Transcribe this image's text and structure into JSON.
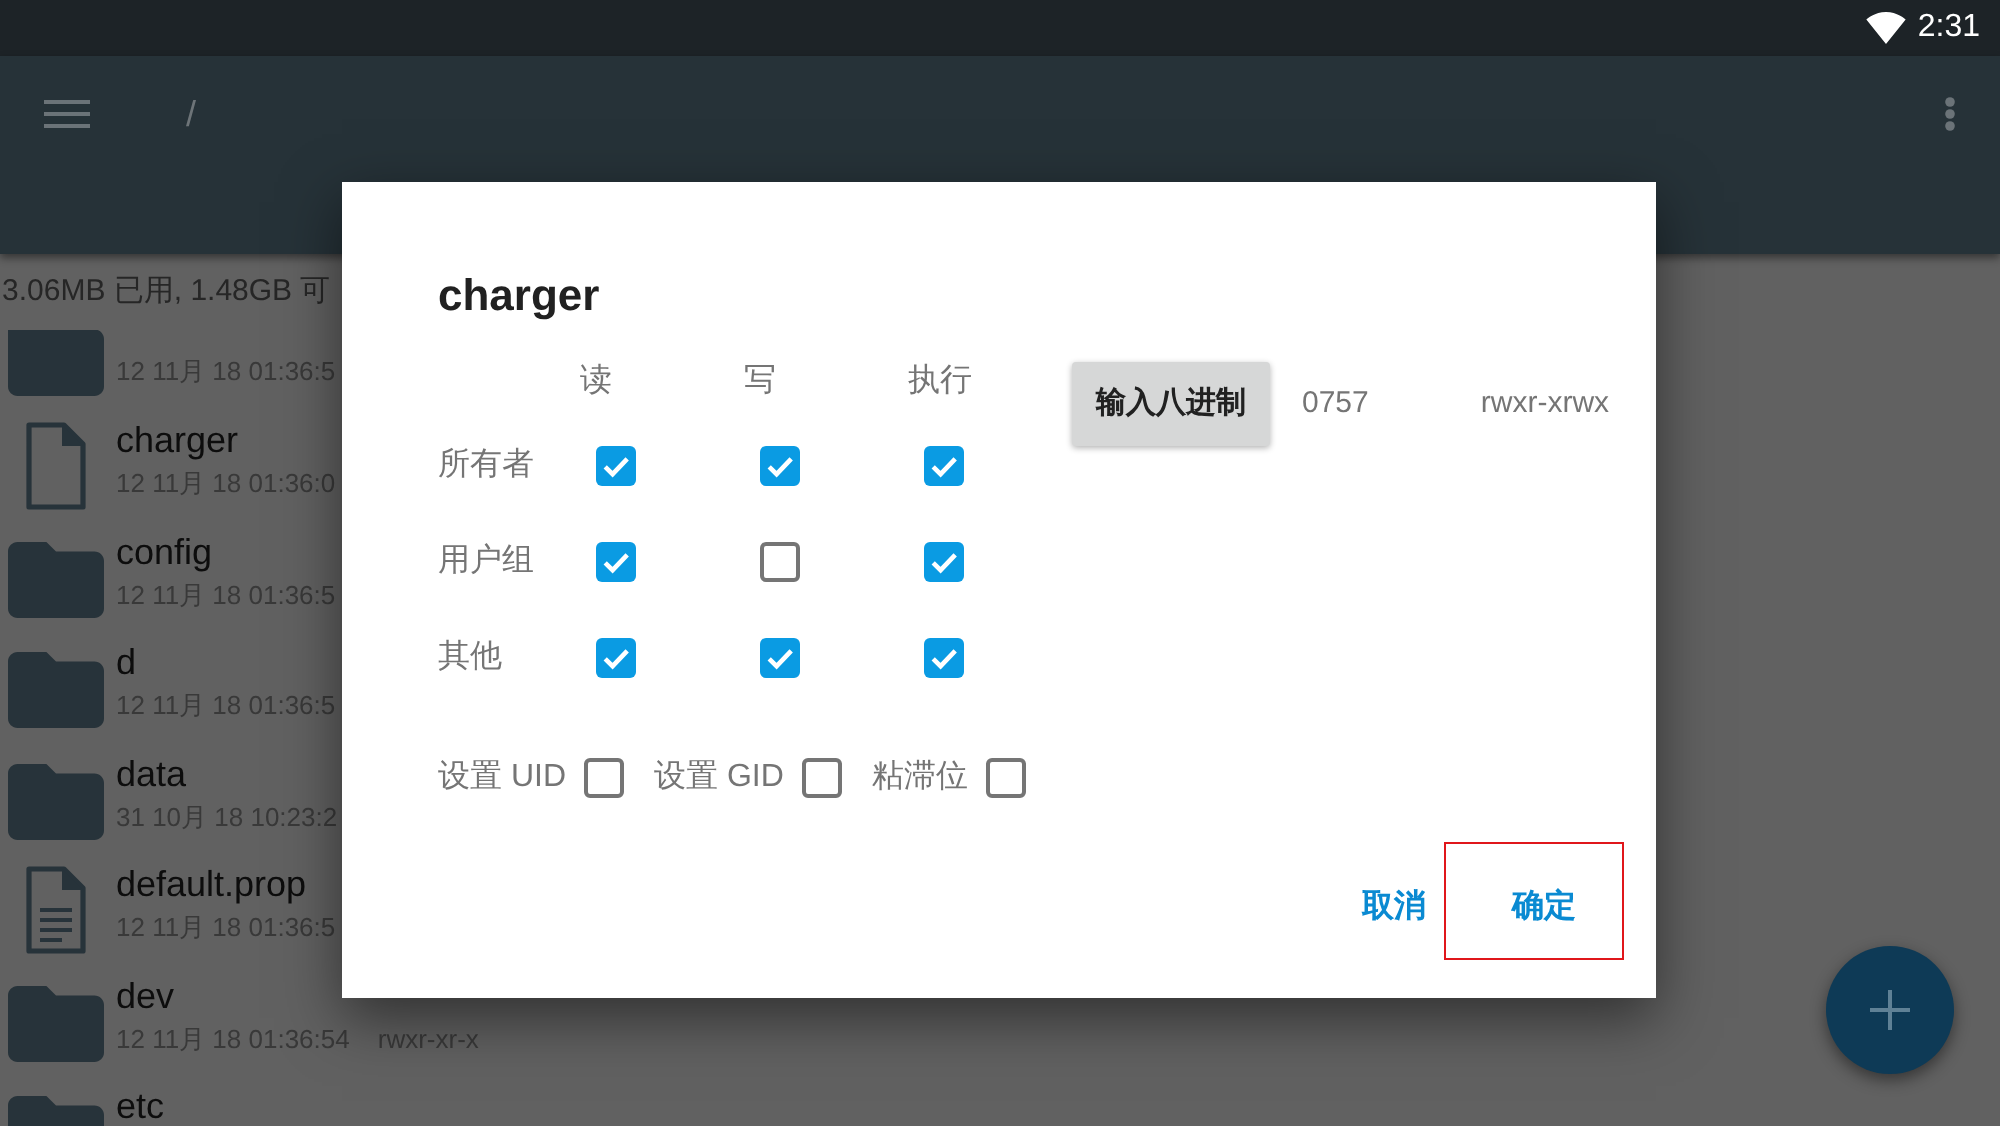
{
  "status_bar": {
    "time": "2:31"
  },
  "toolbar": {
    "path": "/"
  },
  "storage": {
    "text": "3.06MB 已用, 1.48GB 可"
  },
  "files": [
    {
      "kind": "folder",
      "date": "12 11月 18 01:36:5"
    },
    {
      "kind": "file",
      "name": "charger",
      "date": "12 11月 18 01:36:0"
    },
    {
      "kind": "folder",
      "name": "config",
      "date": "12 11月 18 01:36:5"
    },
    {
      "kind": "folder",
      "name": "d",
      "date": "12 11月 18 01:36:5"
    },
    {
      "kind": "folder",
      "name": "data",
      "date": "31 10月 18 10:23:2"
    },
    {
      "kind": "text_file",
      "name": "default.prop",
      "date": "12 11月 18 01:36:5"
    },
    {
      "kind": "folder",
      "name": "dev",
      "date": "12 11月 18 01:36:54",
      "permissions": "rwxr-xr-x"
    },
    {
      "kind": "folder",
      "name": "etc"
    }
  ],
  "dialog": {
    "title": "charger",
    "columns": [
      "读",
      "写",
      "执行"
    ],
    "rows": [
      {
        "label": "所有者",
        "checks": [
          {
            "checked": true
          },
          {
            "checked": true
          },
          {
            "checked": true
          }
        ]
      },
      {
        "label": "用户组",
        "checks": [
          {
            "checked": true
          },
          {
            "checked": false
          },
          {
            "checked": true
          }
        ]
      },
      {
        "label": "其他",
        "checks": [
          {
            "checked": true
          },
          {
            "checked": true
          },
          {
            "checked": true
          }
        ]
      }
    ],
    "octal_button": "输入八进制",
    "octal": "0757",
    "symbolic": "rwxr-xrwx",
    "flags": [
      {
        "label": "设置 UID",
        "checked": false
      },
      {
        "label": "设置 GID",
        "checked": false
      },
      {
        "label": "粘滞位",
        "checked": false
      }
    ],
    "actions": [
      {
        "label": "取消",
        "highlighted": false
      },
      {
        "label": "确定",
        "highlighted": true
      }
    ]
  }
}
